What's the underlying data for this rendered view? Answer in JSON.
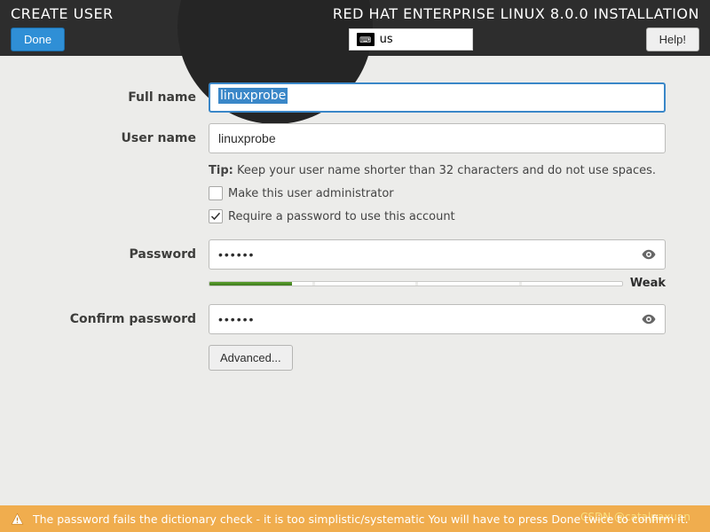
{
  "header": {
    "page_title": "CREATE USER",
    "product_title": "RED HAT ENTERPRISE LINUX 8.0.0 INSTALLATION",
    "done_label": "Done",
    "help_label": "Help!",
    "keyboard_layout": "us"
  },
  "form": {
    "full_name": {
      "label": "Full name",
      "value": "linuxprobe"
    },
    "user_name": {
      "label": "User name",
      "value": "linuxprobe"
    },
    "tip_prefix": "Tip:",
    "tip_text": " Keep your user name shorter than 32 characters and do not use spaces.",
    "admin_checkbox": {
      "label": "Make this user administrator",
      "checked": false
    },
    "require_pw_checkbox": {
      "label": "Require a password to use this account",
      "checked": true
    },
    "password": {
      "label": "Password",
      "value": "••••••",
      "strength_pct": 20,
      "strength_label": "Weak"
    },
    "confirm_password": {
      "label": "Confirm password",
      "value": "••••••"
    },
    "advanced_label": "Advanced..."
  },
  "footer": {
    "warning_text": "The password fails the dictionary check - it is too simplistic/systematic You will have to press Done twice to confirm it."
  },
  "watermark": "CSDN @catalpaxuan",
  "colors": {
    "accent": "#3a87c8",
    "warn": "#f0ad4e",
    "good": "#4f8f26"
  }
}
